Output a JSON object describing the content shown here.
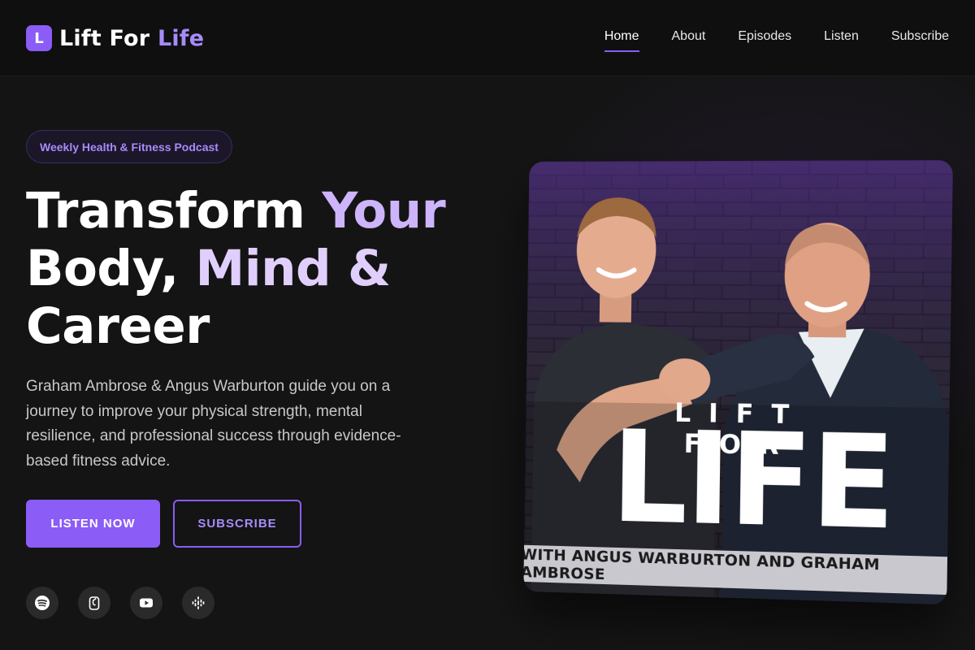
{
  "header": {
    "logo_letter": "L",
    "logo_text_main": "Lift For ",
    "logo_text_accent": "Life",
    "nav": [
      {
        "label": "Home",
        "active": true
      },
      {
        "label": "About"
      },
      {
        "label": "Episodes"
      },
      {
        "label": "Listen"
      },
      {
        "label": "Subscribe"
      }
    ]
  },
  "hero": {
    "badge": "Weekly Health & Fitness Podcast",
    "headline": {
      "part1": "Transform ",
      "part2": "Your",
      "part3": "Body, ",
      "part4": "Mind &",
      "part5": "Career"
    },
    "lead": "Graham Ambrose & Angus Warburton guide you on a journey to improve your physical strength, mental resilience, and professional success through evidence-based fitness advice.",
    "buttons": {
      "primary": "LISTEN NOW",
      "secondary": "SUBSCRIBE"
    },
    "platforms": [
      "spotify-icon",
      "apple-podcasts-icon",
      "youtube-icon",
      "google-podcasts-icon"
    ]
  },
  "cover": {
    "line1": "LIFT FOR",
    "line2": "LIFE",
    "strip": "WITH ANGUS WARBURTON AND GRAHAM AMBROSE"
  },
  "colors": {
    "accent": "#8b5cf6",
    "accent_light": "#a78bfa",
    "background": "#141414"
  }
}
